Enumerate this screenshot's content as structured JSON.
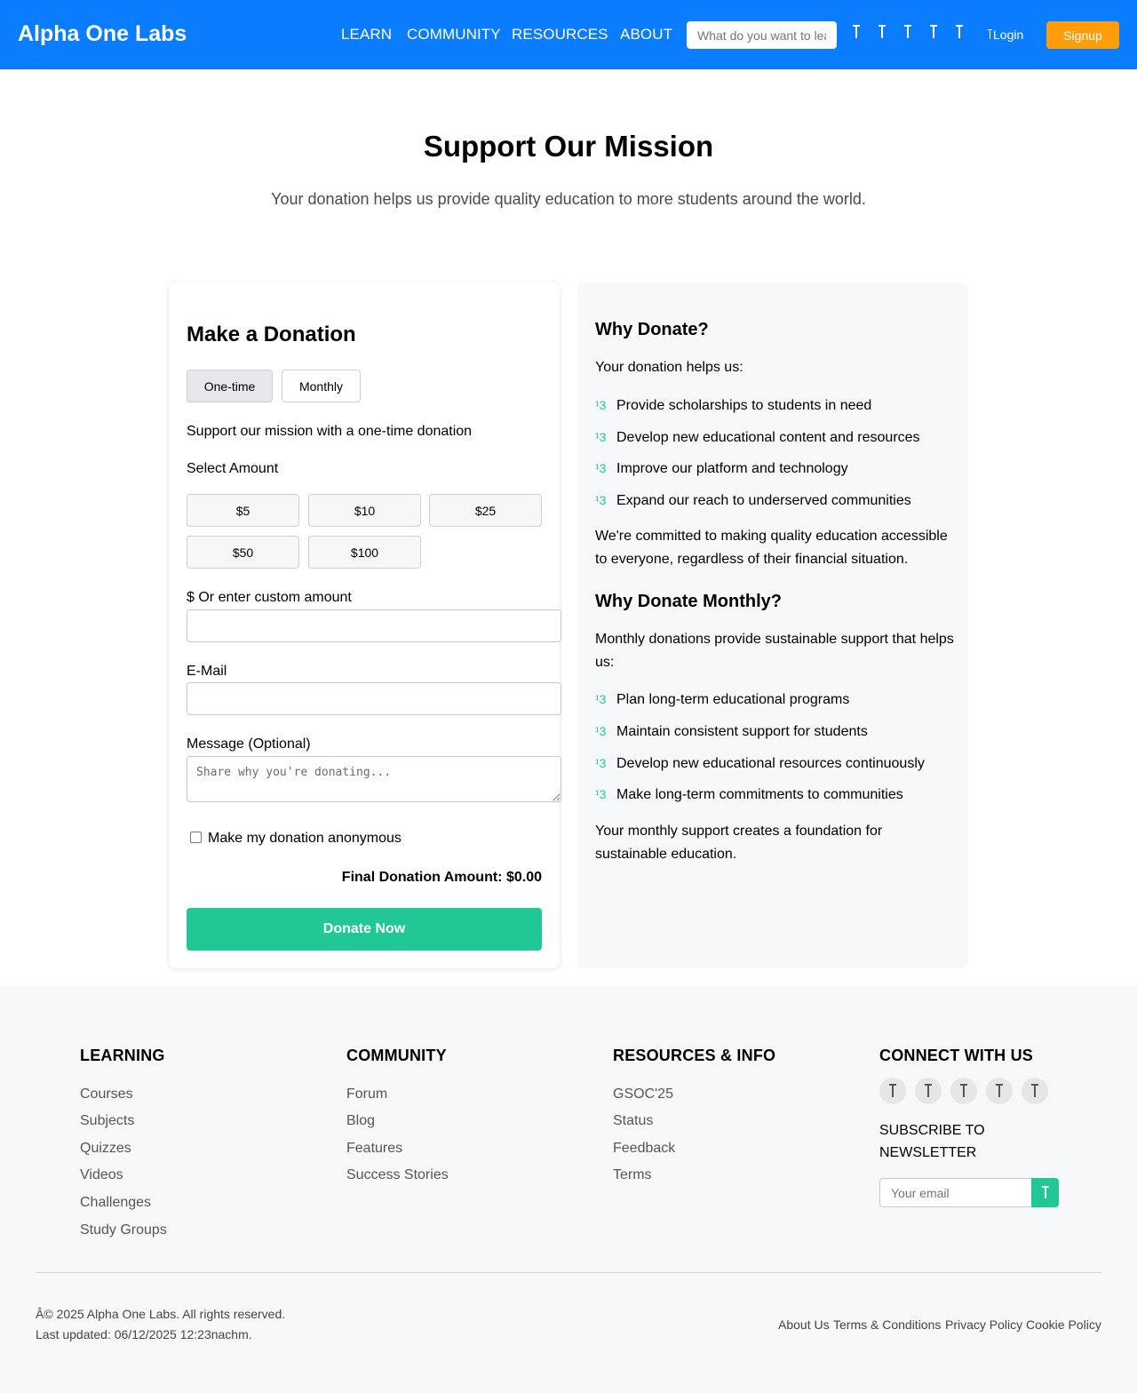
{
  "header": {
    "brand": "Alpha One Labs",
    "nav": [
      "LEARN",
      "COMMUNITY",
      "RESOURCES",
      "ABOUT"
    ],
    "search_placeholder": "What do you want to learn?",
    "icons": [
      "icon-1",
      "icon-2",
      "icon-3",
      "icon-4",
      "icon-5"
    ],
    "login": "Login",
    "signup": "Signup",
    "colors": {
      "bar": "#0a7cff",
      "signup": "#ff9e0a"
    }
  },
  "hero": {
    "title": "Support Our Mission",
    "subtitle": "Your donation helps us provide quality education to more students around the world."
  },
  "donation": {
    "title": "Make a Donation",
    "frequency": {
      "one_time": "One-time",
      "monthly": "Monthly",
      "selected": "One-time"
    },
    "description": "Support our mission with a one-time donation",
    "select_amount_label": "Select Amount",
    "amounts": [
      "$5",
      "$10",
      "$25",
      "$50",
      "$100"
    ],
    "custom_label": "$ Or enter custom amount",
    "custom_value": "",
    "email_label": "E-Mail",
    "email_value": "",
    "message_label": "Message (Optional)",
    "message_placeholder": "Share why you're donating...",
    "anonymous_label": "Make my donation anonymous",
    "anonymous_checked": false,
    "final_amount": "Final Donation Amount: $0.00",
    "donate_button": "Donate Now",
    "colors": {
      "donate": "#21c896"
    }
  },
  "why": {
    "title": "Why Donate?",
    "intro": "Your donation helps us:",
    "check_glyph": "¹3",
    "bullets": [
      "Provide scholarships to students in need",
      "Develop new educational content and resources",
      "Improve our platform and technology",
      "Expand our reach to underserved communities"
    ],
    "closing": "We're committed to making quality education accessible to everyone, regardless of their financial situation.",
    "monthly_title": "Why Donate Monthly?",
    "monthly_intro": "Monthly donations provide sustainable support that helps us:",
    "monthly_bullets": [
      "Plan long-term educational programs",
      "Maintain consistent support for students",
      "Develop new educational resources continuously",
      "Make long-term commitments to communities"
    ],
    "monthly_closing": "Your monthly support creates a foundation for sustainable education."
  },
  "footer": {
    "learning": {
      "title": "LEARNING",
      "links": [
        "Courses",
        "Subjects",
        "Quizzes",
        "Videos",
        "Challenges",
        "Study Groups"
      ]
    },
    "community": {
      "title": "COMMUNITY",
      "links": [
        "Forum",
        "Blog",
        "Features",
        "Success Stories"
      ]
    },
    "resources": {
      "title": "RESOURCES & INFO",
      "links": [
        "GSOC'25",
        "Status",
        "Feedback",
        "Terms"
      ]
    },
    "connect": {
      "title": "CONNECT WITH US",
      "social_icons": [
        "social-1",
        "social-2",
        "social-3",
        "social-4",
        "social-5"
      ],
      "subscribe_title": "SUBSCRIBE TO NEWSLETTER",
      "email_placeholder": "Your email"
    },
    "copyright": "Â© 2025 Alpha One Labs. All rights reserved.",
    "last_updated": "Last updated: 06/12/2025 12:23nachm.",
    "legal_links": [
      "About Us",
      "Terms & Conditions",
      "Privacy Policy",
      "Cookie Policy"
    ]
  }
}
